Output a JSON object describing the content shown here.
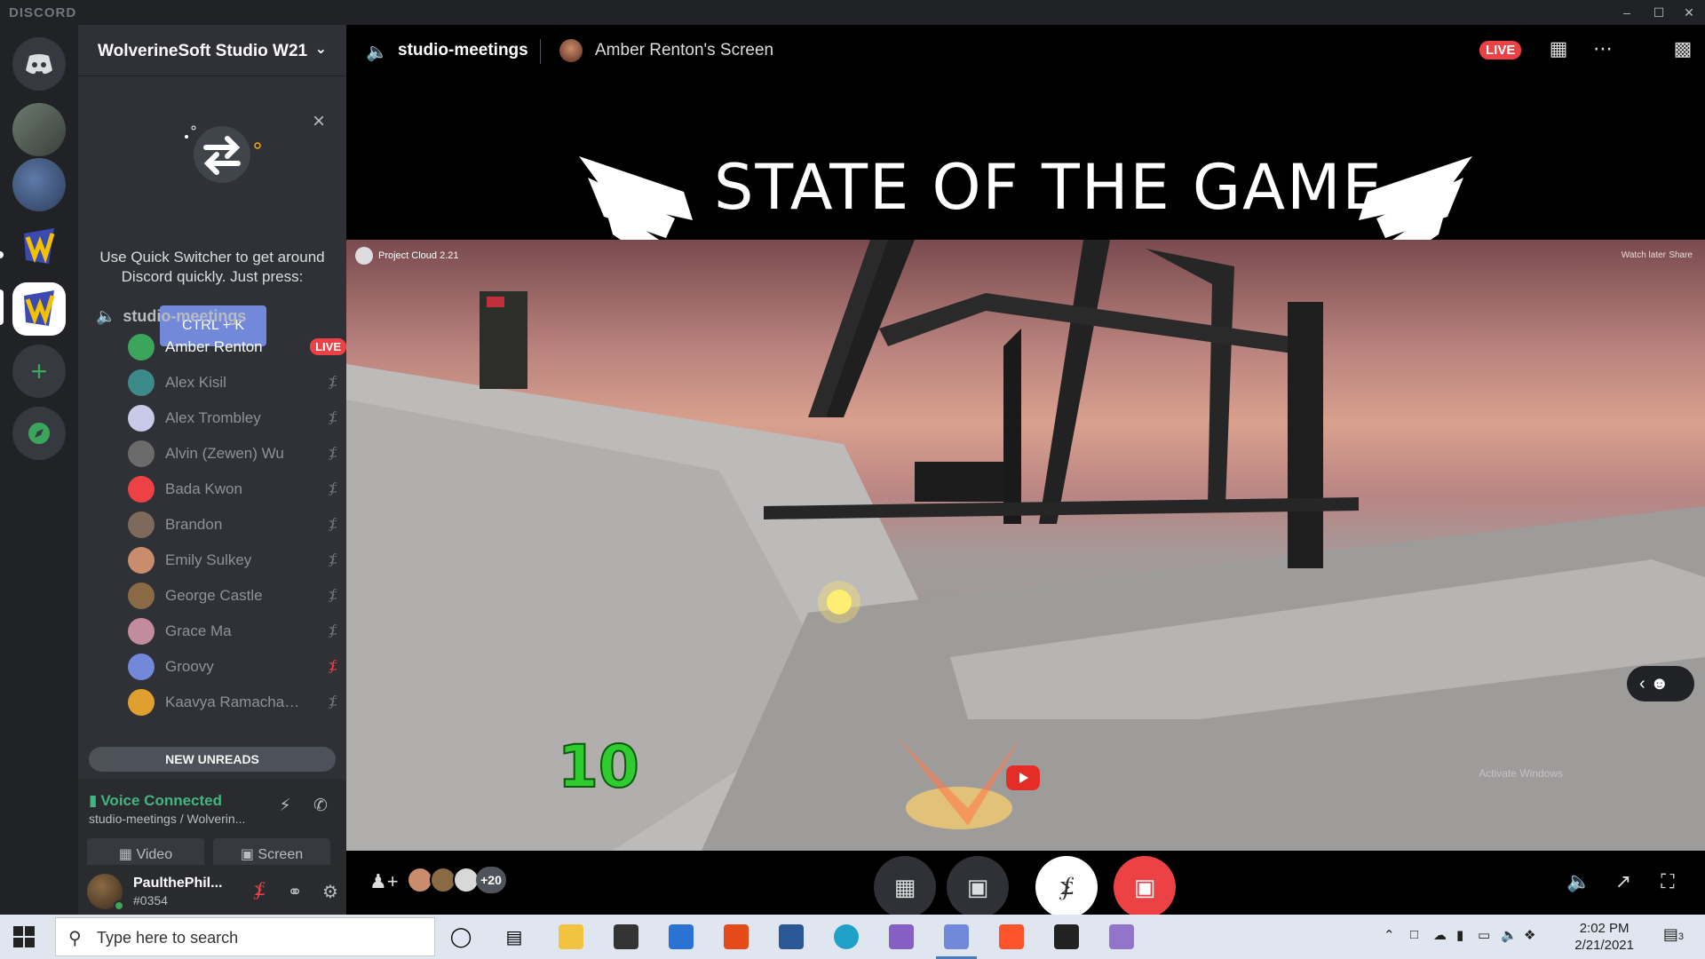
{
  "window": {
    "brand": "DISCORD"
  },
  "server": {
    "name": "WolverineSoft Studio W21"
  },
  "quick_switcher": {
    "text": "Use Quick Switcher to get around Discord quickly. Just press:",
    "shortcut": "CTRL + K"
  },
  "voice_channel": {
    "name": "studio-meetings"
  },
  "members": [
    {
      "name": "Amber Renton",
      "live": "LIVE",
      "color": "#3ba55c"
    },
    {
      "name": "Alex Kisil",
      "color": "#3d8a8a"
    },
    {
      "name": "Alex Trombley",
      "color": "#c9c9e8"
    },
    {
      "name": "Alvin (Zewen) Wu",
      "color": "#6b6b6b"
    },
    {
      "name": "Bada Kwon",
      "color": "#ed4245"
    },
    {
      "name": "Brandon",
      "color": "#7d6a5a"
    },
    {
      "name": "Emily Sulkey",
      "color": "#c98c6c"
    },
    {
      "name": "George Castle",
      "color": "#8a6a45"
    },
    {
      "name": "Grace Ma",
      "color": "#c38c9e"
    },
    {
      "name": "Groovy",
      "color": "#7289da"
    },
    {
      "name": "Kaavya Ramachand...",
      "color": "#e0a030"
    }
  ],
  "new_unreads": "NEW UNREADS",
  "voice_status": {
    "title": "Voice Connected",
    "sub": "studio-meetings / Wolverin...",
    "video_label": "Video",
    "screen_label": "Screen"
  },
  "user": {
    "name": "PaulthePhil...",
    "tag": "#0354"
  },
  "stage": {
    "channel": "studio-meetings",
    "screen_title": "Amber Renton's Screen",
    "live": "LIVE",
    "banner_title": "STATE OF THE GAME",
    "yt_title": "Project Cloud 2.21",
    "yt_watch_later": "Watch later",
    "yt_share": "Share",
    "score": "10",
    "watermark": "Activate Windows",
    "extra_viewers": "+20"
  },
  "taskbar": {
    "search_placeholder": "Type here to search",
    "time": "2:02 PM",
    "date": "2/21/2021",
    "notif_count": "3"
  }
}
